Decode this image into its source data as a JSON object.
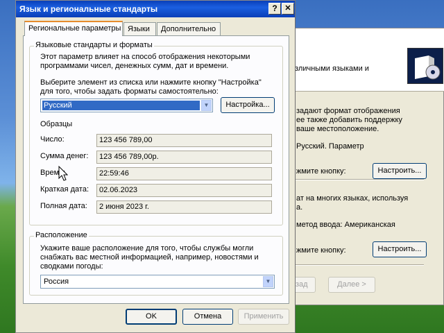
{
  "background_window": {
    "lines": [
      {
        "text": "зличными языками и"
      },
      {
        "text": "задают формат отображения"
      },
      {
        "text": "ее также добавить поддержку"
      },
      {
        "text": "ваше местоположение."
      },
      {
        "text": "Русский. Параметр"
      },
      {
        "text": "жмите кнопку:"
      },
      {
        "text": "ат на многих языках, используя"
      },
      {
        "text": "а."
      },
      {
        "text": "метод ввода: Американская"
      },
      {
        "text": "жмите кнопку:"
      }
    ],
    "buttons": {
      "configure1": "Настроить...",
      "configure2": "Настроить...",
      "back": "азад",
      "next": "Далее >"
    },
    "icon": "cd-box-icon"
  },
  "dialog": {
    "title": "Язык и региональные стандарты",
    "help_button": "?",
    "close_button": "✕",
    "tabs": [
      {
        "label": "Региональные параметры",
        "active": true
      },
      {
        "label": "Языки",
        "active": false
      },
      {
        "label": "Дополнительно",
        "active": false
      }
    ],
    "standards_group": {
      "legend": "Языковые стандарты и форматы",
      "description": [
        "Этот параметр влияет на способ отображения некоторыми",
        "программами чисел, денежных сумм, дат и времени."
      ],
      "instruction": [
        "Выберите элемент из списка или нажмите кнопку \"Настройка\"",
        "для того, чтобы задать форматы самостоятельно:"
      ],
      "selected_locale": "Русский",
      "customize_button": "Настройка...",
      "samples_label": "Образцы",
      "samples": [
        {
          "label": "Число:",
          "value": "123 456 789,00"
        },
        {
          "label": "Сумма денег:",
          "value": "123 456 789,00р."
        },
        {
          "label": "Время:",
          "value": "22:59:46"
        },
        {
          "label": "Краткая дата:",
          "value": "02.06.2023"
        },
        {
          "label": "Полная дата:",
          "value": "2 июня 2023 г."
        }
      ]
    },
    "location_group": {
      "legend": "Расположение",
      "description": [
        "Укажите ваше расположение для того, чтобы службы могли",
        "снабжать вас местной информацией, например, новостями и",
        "сводками погоды:"
      ],
      "selected_location": "Россия"
    },
    "buttons": {
      "ok": "OK",
      "cancel": "Отмена",
      "apply": "Применить"
    }
  },
  "colors": {
    "titlebar": "#0a3fb8",
    "selection": "#316ac5",
    "tab_accent": "#e68b2c"
  }
}
